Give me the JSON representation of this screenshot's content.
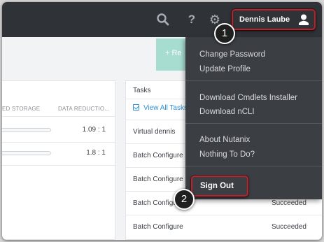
{
  "topbar": {
    "icons": [
      "search-icon",
      "help-icon",
      "gear-icon",
      "user-icon"
    ],
    "help_glyph": "?",
    "gear_glyph": "⚙",
    "user_name": "Dennis Laube"
  },
  "add_button": {
    "label": "+ Re"
  },
  "storage_panel": {
    "columns": [
      "ED STORAGE",
      "DATA REDUCTIO..."
    ],
    "rows": [
      {
        "data_reduction": "1.09 : 1"
      },
      {
        "data_reduction": "1.8 : 1"
      }
    ]
  },
  "tasks_panel": {
    "title": "Tasks",
    "view_all": "View All Tasks",
    "rows": [
      {
        "name": "Virtual dennis",
        "status": ""
      },
      {
        "name": "Batch Configure",
        "status": ""
      },
      {
        "name": "Batch Configure",
        "status": ""
      },
      {
        "name": "Batch Configure",
        "status": "Succeeded"
      },
      {
        "name": "Batch Configure",
        "status": "Succeeded"
      }
    ]
  },
  "user_menu": {
    "items": [
      "Change Password",
      "Update Profile",
      "Download Cmdlets Installer",
      "Download nCLI",
      "About Nutanix",
      "Nothing To Do?"
    ],
    "sign_out": "Sign Out"
  },
  "callouts": [
    "1",
    "2"
  ],
  "colors": {
    "topbar": "#2f3237",
    "menu_bg": "#3b3e43",
    "highlight": "#c0202a",
    "link": "#2e8fd6",
    "add_button": "#a7ddd1"
  }
}
